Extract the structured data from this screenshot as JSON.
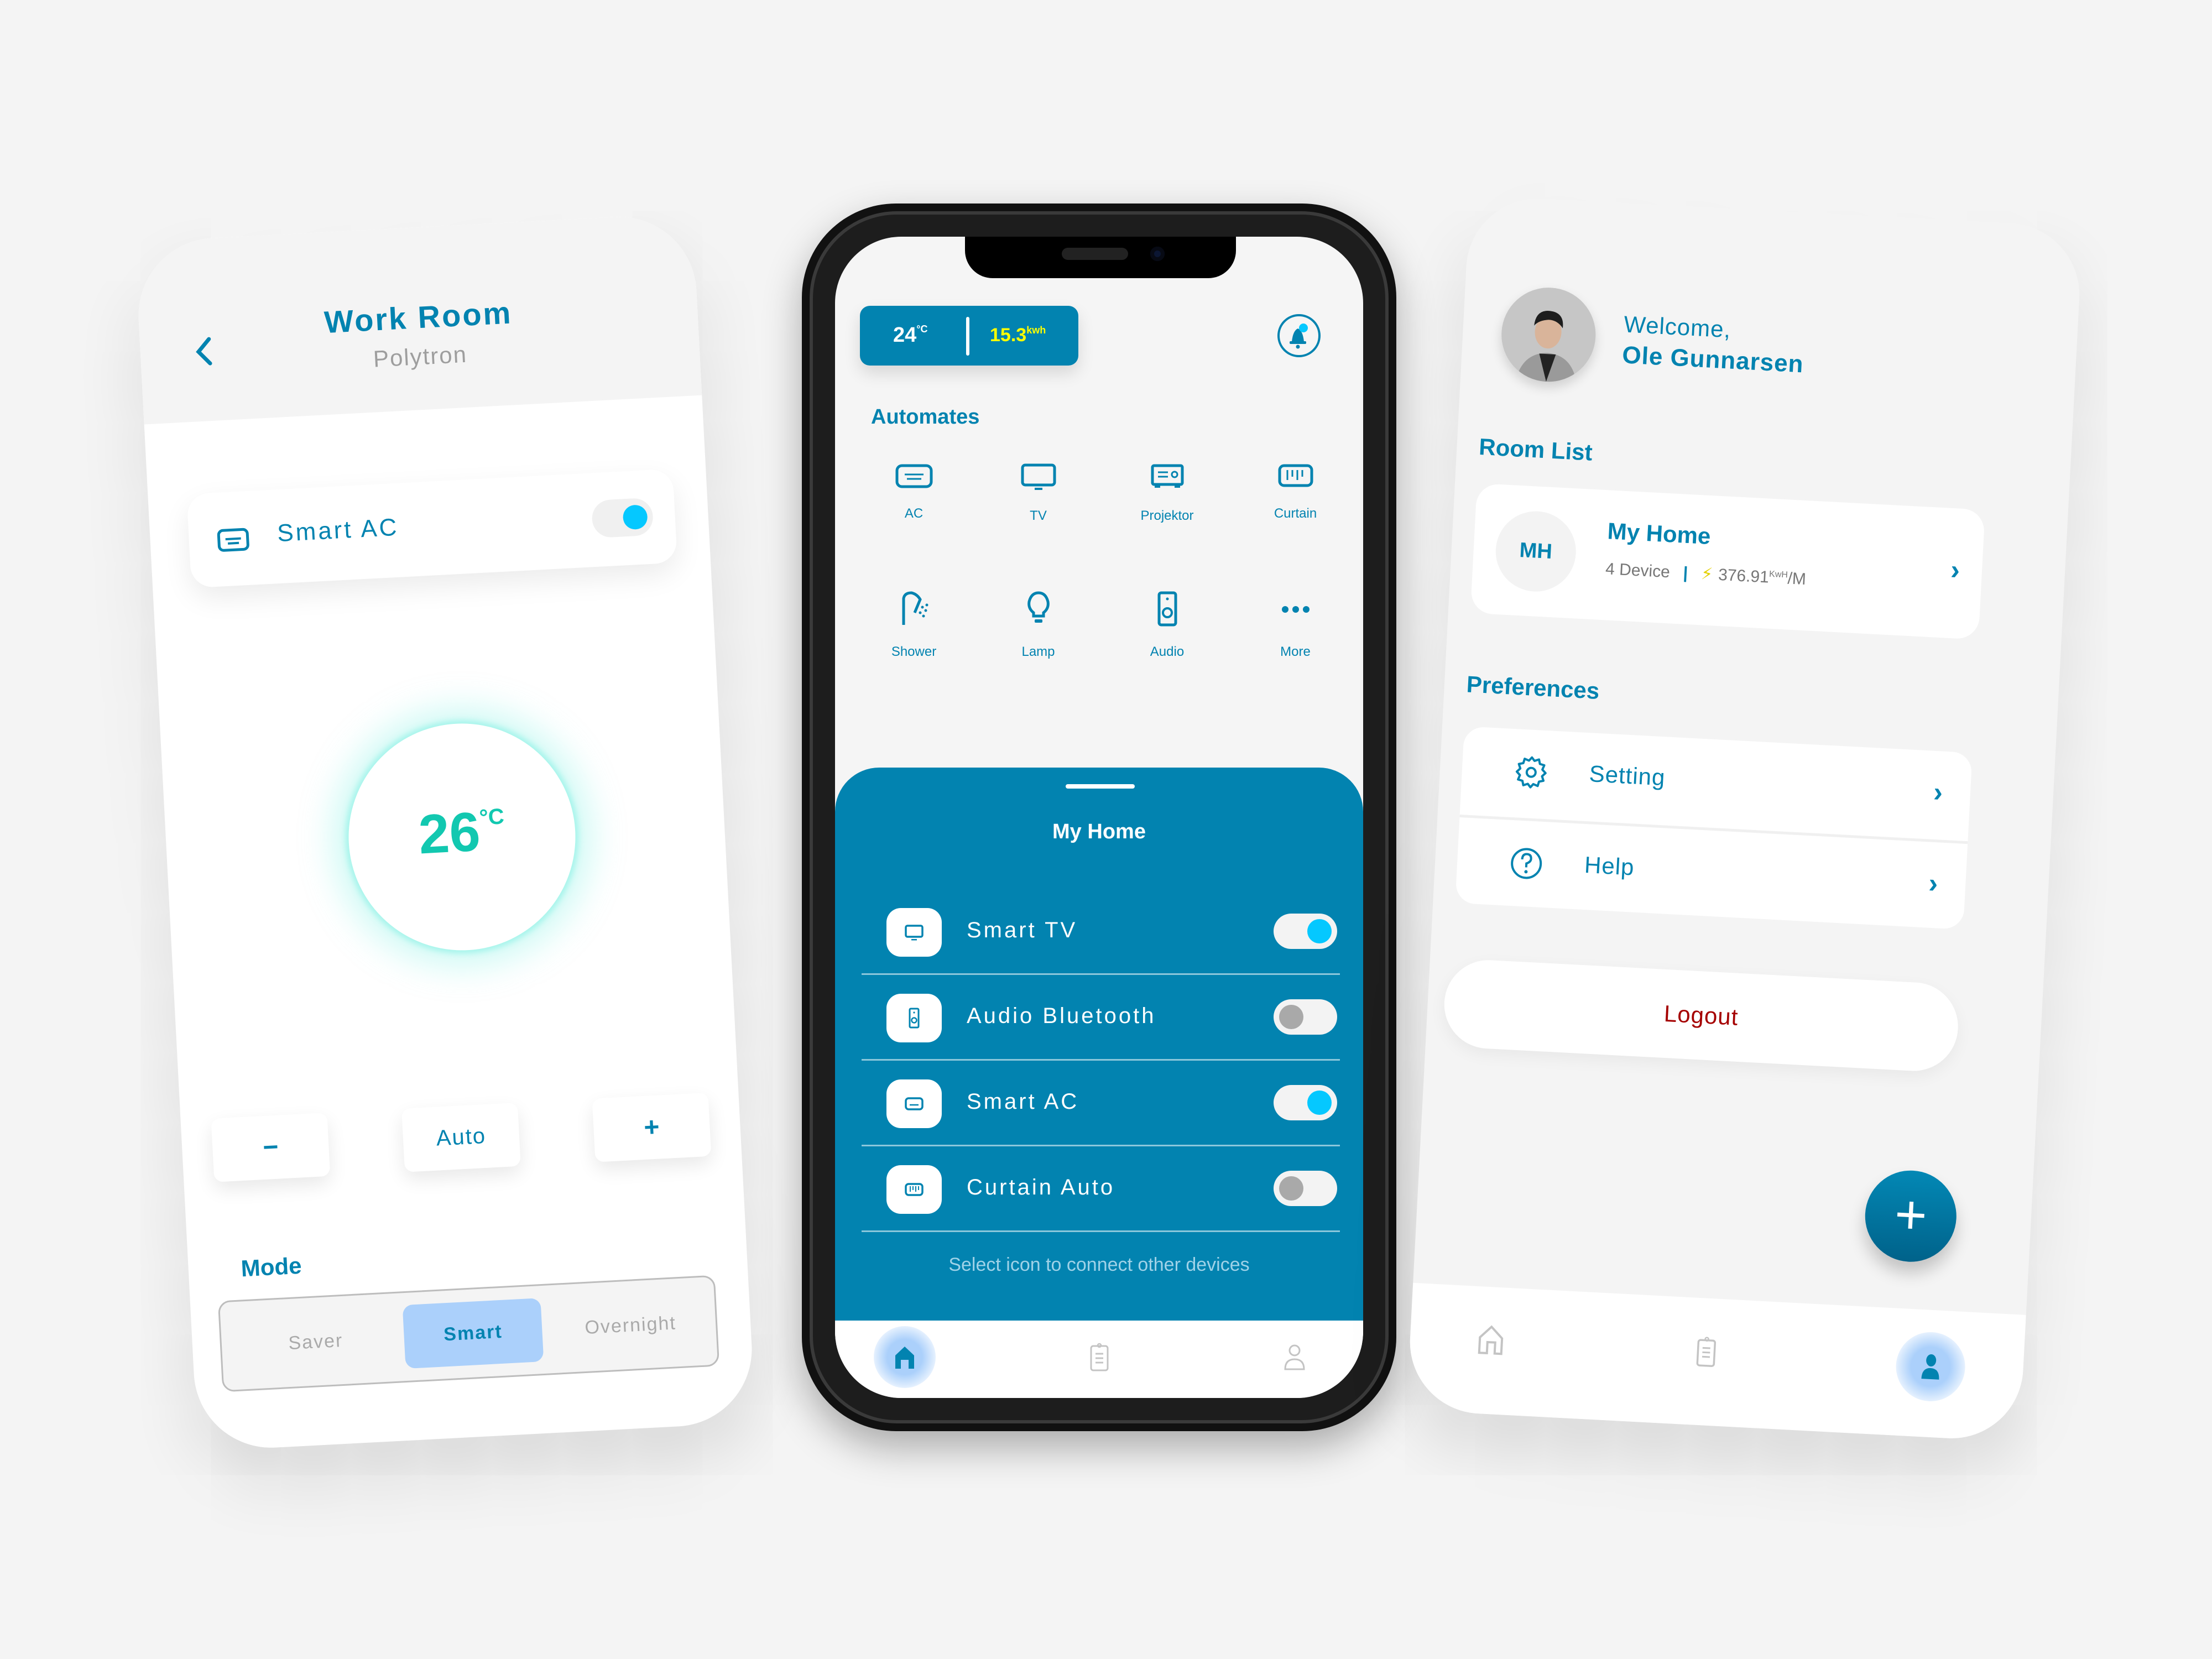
{
  "colors": {
    "brand": "#0283b0",
    "toggle_on": "#05c8ff",
    "toggle_off": "#a9a9a9",
    "energy": "#ffff00",
    "logout": "#a50000",
    "temp_dial": "#12c8b0",
    "mode_selected_bg": "#abd0fb",
    "background": "#f4f4f4"
  },
  "left_screen": {
    "header": {
      "back_icon": "chevron-left-icon",
      "title": "Work Room",
      "subtitle": "Polytron"
    },
    "device_card": {
      "icon": "ac-icon",
      "label": "Smart AC",
      "toggle_on": true
    },
    "temperature": {
      "value": "26",
      "unit": "°C"
    },
    "controls": {
      "decrease": "−",
      "mode": "Auto",
      "increase": "+"
    },
    "mode": {
      "label": "Mode",
      "options": [
        "Saver",
        "Smart",
        "Overnight"
      ],
      "selected": "Smart"
    }
  },
  "center_screen": {
    "status": {
      "temperature": "24",
      "temp_unit": "°C",
      "energy": "15.3",
      "energy_unit": "kwh"
    },
    "notification_icon": "bell-icon",
    "automates": {
      "title": "Automates",
      "items": [
        {
          "label": "AC",
          "icon": "ac-icon"
        },
        {
          "label": "TV",
          "icon": "tv-icon"
        },
        {
          "label": "Projektor",
          "icon": "projector-icon"
        },
        {
          "label": "Curtain",
          "icon": "curtain-icon"
        },
        {
          "label": "Shower",
          "icon": "shower-icon"
        },
        {
          "label": "Lamp",
          "icon": "lamp-icon"
        },
        {
          "label": "Audio",
          "icon": "speaker-icon"
        },
        {
          "label": "More",
          "icon": "more-icon"
        }
      ]
    },
    "sheet": {
      "title": "My Home",
      "devices": [
        {
          "label": "Smart TV",
          "icon": "tv-icon",
          "on": true
        },
        {
          "label": "Audio Bluetooth",
          "icon": "speaker-icon",
          "on": false
        },
        {
          "label": "Smart AC",
          "icon": "ac-icon",
          "on": true
        },
        {
          "label": "Curtain Auto",
          "icon": "curtain-icon",
          "on": false
        }
      ],
      "hint": "Select icon to connect other devices"
    },
    "bottom_nav": [
      {
        "name": "home",
        "active": true
      },
      {
        "name": "clipboard",
        "active": false
      },
      {
        "name": "profile",
        "active": false
      }
    ]
  },
  "right_screen": {
    "welcome": "Welcome,",
    "user_name": "Ole Gunnarsen",
    "room_list": {
      "title": "Room List",
      "rooms": [
        {
          "initials": "MH",
          "name": "My Home",
          "devices": "4 Device",
          "energy": "376.91",
          "energy_unit": "KwH",
          "energy_period": "/M"
        }
      ]
    },
    "preferences": {
      "title": "Preferences",
      "items": [
        {
          "label": "Setting",
          "icon": "gear-icon"
        },
        {
          "label": "Help",
          "icon": "help-icon"
        }
      ]
    },
    "logout_label": "Logout",
    "fab_label": "+",
    "bottom_nav": [
      {
        "name": "home",
        "active": false
      },
      {
        "name": "clipboard",
        "active": false
      },
      {
        "name": "profile",
        "active": true
      }
    ]
  }
}
